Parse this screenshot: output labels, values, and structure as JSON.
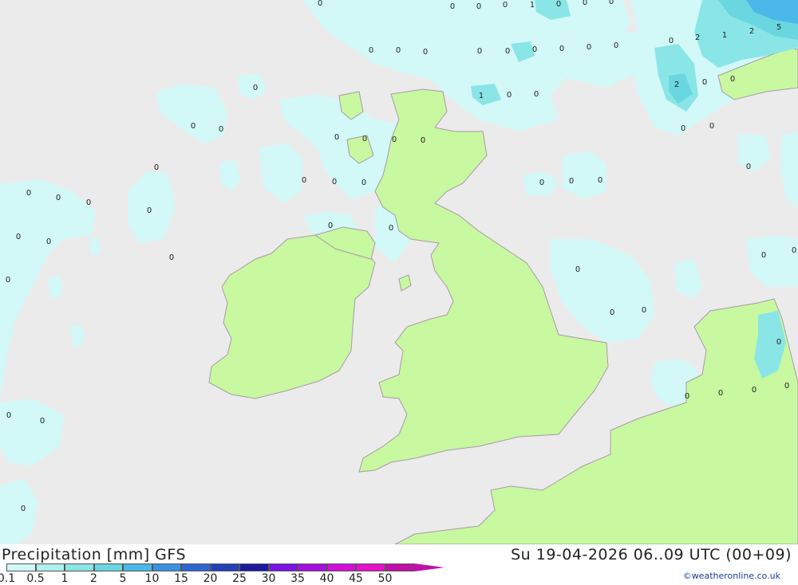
{
  "header": {
    "title": "Precipitation [mm] GFS",
    "timestamp": "Su 19-04-2026 06..09 UTC (00+09)",
    "credit": "©weatheronline.co.uk"
  },
  "legend": {
    "unit": "mm",
    "levels": [
      "0.1",
      "0.5",
      "1",
      "2",
      "5",
      "10",
      "15",
      "20",
      "25",
      "30",
      "35",
      "40",
      "45",
      "50"
    ],
    "colors": [
      "#d2f8f8",
      "#aef0f0",
      "#8ae6e6",
      "#6ad6e0",
      "#4ab8e8",
      "#3a92e0",
      "#2c66d2",
      "#2340b8",
      "#1a1aa0",
      "#7a12e6",
      "#a40ee0",
      "#d20ed8",
      "#e810c8",
      "#c010a8"
    ]
  },
  "map": {
    "colors": {
      "sea": "#ebebeb",
      "land": "#c8f8a0",
      "border": "#a89aa8",
      "precip_light": "#d2f8f8",
      "precip_mid": "#8ae6e6",
      "precip_heavy": "#4ab8e8"
    },
    "values": [
      "0",
      "0",
      "0",
      "0",
      "1",
      "0",
      "0",
      "0",
      "0",
      "0",
      "0",
      "0",
      "0",
      "0",
      "0",
      "0",
      "0",
      "2",
      "1",
      "2",
      "5",
      "0",
      "2",
      "0",
      "0",
      "1",
      "0",
      "0",
      "0",
      "0",
      "0",
      "0",
      "0",
      "0",
      "0",
      "0",
      "0",
      "0",
      "0",
      "0",
      "0",
      "0",
      "0",
      "0",
      "0",
      "0",
      "0",
      "0",
      "0",
      "0",
      "0",
      "0",
      "0",
      "0",
      "0",
      "0",
      "0",
      "0",
      "0",
      "0",
      "0",
      "0",
      "0",
      "0",
      "0",
      "0",
      "0",
      "0",
      "0",
      "0",
      "0",
      "0",
      "0",
      "0",
      "0"
    ]
  }
}
